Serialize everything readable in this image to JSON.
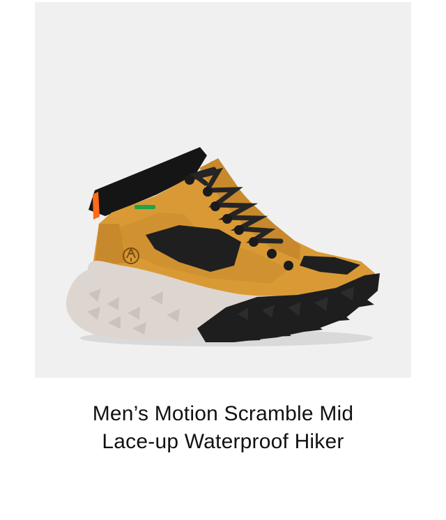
{
  "product": {
    "image": {
      "subject": "boot-icon",
      "background_color": "#f0f0f0",
      "colors": {
        "upper": "#d99a35",
        "upper_shadow": "#b77a22",
        "mesh": "#1f1f1f",
        "collar": "#151515",
        "laces": "#252525",
        "pull_tab": "#ff6b1a",
        "midsole": "#ddd6d0",
        "outsole": "#1e1e1e",
        "waterproof_badge": "#21a34a"
      }
    },
    "title_lines": [
      "Men’s Motion Scramble Mid",
      "Lace-up Waterproof Hiker"
    ]
  }
}
